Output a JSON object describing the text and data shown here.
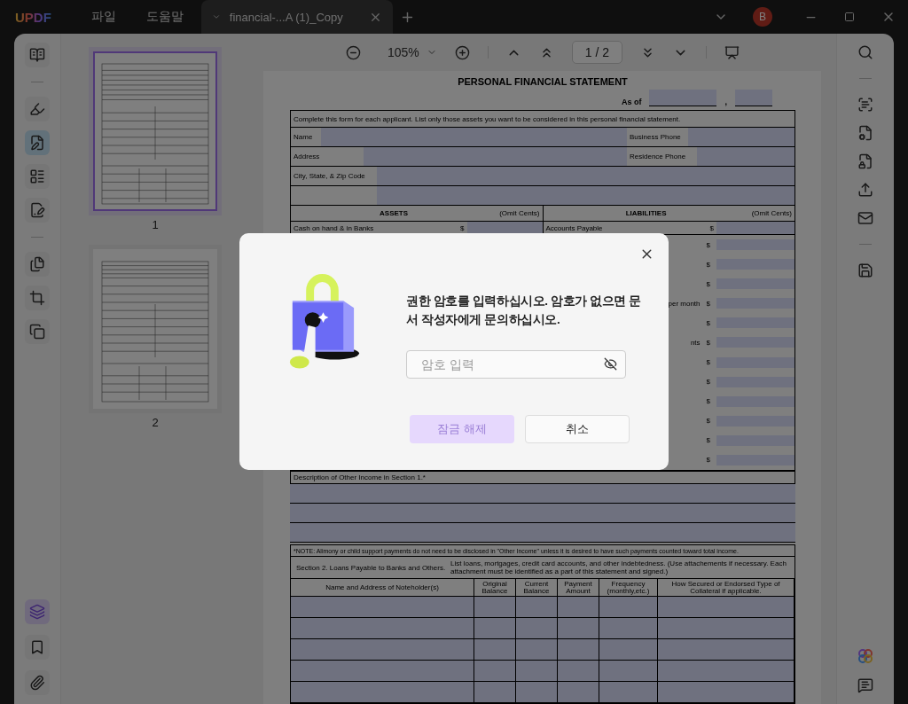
{
  "app": {
    "logo": "UPDF",
    "menus": [
      "파일",
      "도움말"
    ]
  },
  "tabs": [
    {
      "title": "financial-...A (1)_Copy",
      "selected": true
    }
  ],
  "user": {
    "initial": "B"
  },
  "left_tool_groups": [
    [
      {
        "kind": "reader",
        "selected": false
      }
    ],
    [
      {
        "kind": "highlight",
        "selected": false
      },
      {
        "kind": "edit",
        "selected": true
      },
      {
        "kind": "form",
        "selected": false
      },
      {
        "kind": "sign",
        "selected": false
      }
    ],
    [
      {
        "kind": "organize",
        "selected": false
      },
      {
        "kind": "crop",
        "selected": false
      },
      {
        "kind": "batch",
        "selected": false
      }
    ]
  ],
  "left_bottom_tools": [
    {
      "kind": "layers",
      "selected": true
    },
    {
      "kind": "bookmark",
      "selected": false
    },
    {
      "kind": "attachment",
      "selected": false
    }
  ],
  "thumbnails": [
    {
      "label": "1",
      "selected": true
    },
    {
      "label": "2",
      "selected": false
    }
  ],
  "toolbar": {
    "zoom": "105%",
    "page": "1 / 2"
  },
  "document": {
    "title": "PERSONAL FINANCIAL STATEMENT",
    "as_of": "As of",
    "comma": ",",
    "instruction": "Complete this form for each applicant.  List only those assets you want to be considered in this personal financial statement.",
    "name_label": "Name",
    "business_phone": "Business Phone",
    "address_label": "Address",
    "residence_phone": "Residence Phone",
    "city_label": "City, State, & Zip Code",
    "assets": "ASSETS",
    "assets_note": "(Omit Cents)",
    "liabilities": "LIABILITIES",
    "liabilities_note": "(Omit Cents)",
    "cash_label": "Cash on hand & in Banks",
    "cash_dollar": "$",
    "payable_label": "Accounts Payable",
    "payable_dollar": "$",
    "liability_rows": [
      {
        "label": "",
        "dollar": "$"
      },
      {
        "label": "",
        "dollar": "$"
      },
      {
        "label": "",
        "dollar": "$"
      },
      {
        "label": "per month",
        "dollar": "$"
      },
      {
        "label": "",
        "dollar": "$"
      },
      {
        "label": "nts",
        "dollar": "$"
      },
      {
        "label": "",
        "dollar": "$"
      },
      {
        "label": "",
        "dollar": "$"
      },
      {
        "label": "",
        "dollar": "$"
      },
      {
        "label": "",
        "dollar": "$"
      },
      {
        "label": "",
        "dollar": "$"
      },
      {
        "label": "",
        "dollar": "$"
      }
    ],
    "description": "Description of Other Income in Section 1.*",
    "note": "*NOTE: Alimony or child support payments do not need to be disclosed in \"Other Income\" unless it is desired to have such payments counted toward total income.",
    "section2": "Section 2. Loans Payable to Banks and Others.",
    "section2_text": "List loans, mortgages, credit card accounts, and other indebtedness. (Use attachements if necessary. Each attachment must be identified as a part of this statement and signed.)",
    "loan_columns": [
      "Name and Address of Noteholder(s)",
      "Original Balance",
      "Current Balance",
      "Payment Amount",
      "Frequency (monthly,etc.)",
      "How Secured or Endorsed Type of Collateral if applicable."
    ]
  },
  "dialog": {
    "message": "권한 암호를 입력하십시오. 암호가 없으면 문서 작성자에게 문의하십시오.",
    "placeholder": "암호 입력",
    "buttons": [
      {
        "label": "잠금 해제",
        "kind": "primary",
        "disabled": true
      },
      {
        "label": "취소",
        "kind": "secondary",
        "disabled": false
      }
    ]
  }
}
